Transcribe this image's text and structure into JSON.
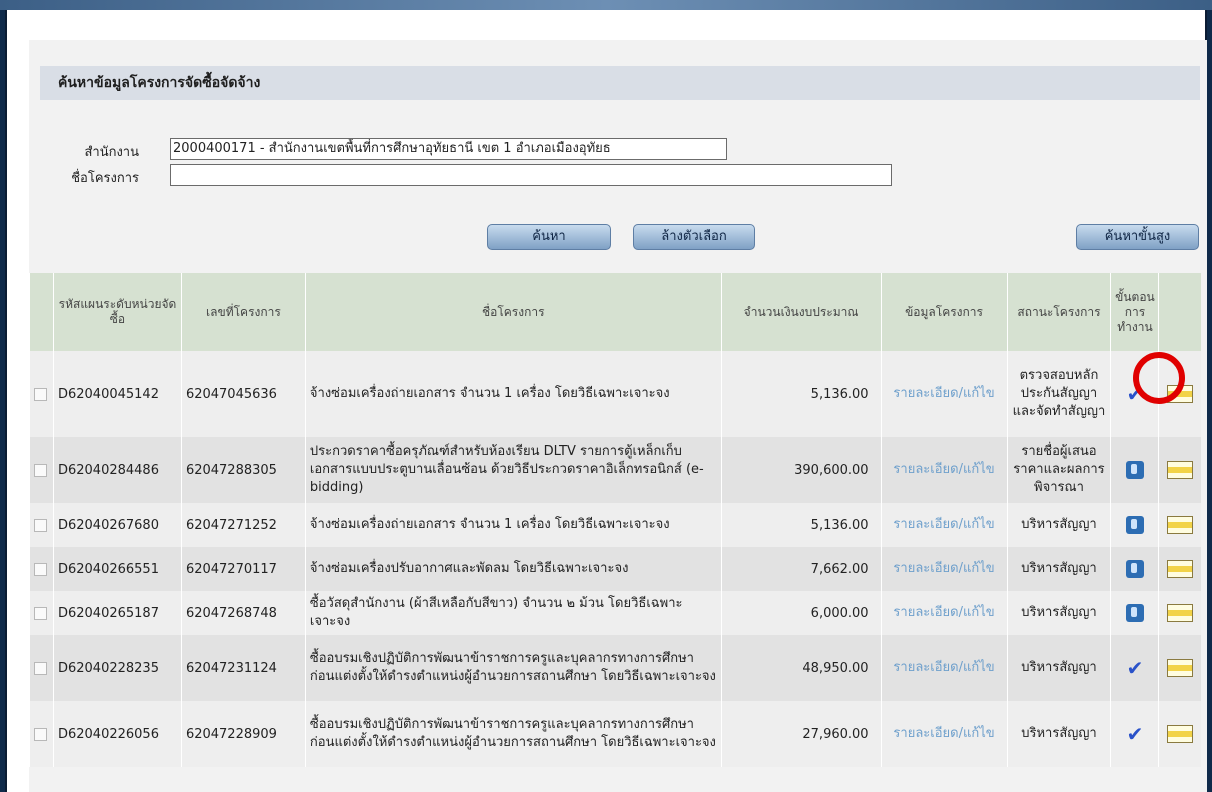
{
  "search": {
    "section_title": "ค้นหาข้อมูลโครงการจัดซื้อจัดจ้าง",
    "office_label": "สำนักงาน",
    "office_value": "2000400171 - สำนักงานเขตพื้นที่การศึกษาอุทัยธานี เขต 1 อำเภอเมืองอุทัยธ",
    "project_label": "ชื่อโครงการ",
    "project_value": "",
    "search_button": "ค้นหา",
    "clear_button": "ล้างตัวเลือก",
    "advanced_button": "ค้นหาขั้นสูง"
  },
  "table": {
    "headers": {
      "plan_code": "รหัสแผนระดับหน่วยจัดซื้อ",
      "project_no": "เลขที่โครงการ",
      "project_name": "ชื่อโครงการ",
      "budget": "จำนวนเงินงบประมาณ",
      "info": "ข้อมูลโครงการ",
      "status": "สถานะโครงการ",
      "step": "ขั้นตอนการทำงาน"
    },
    "rows": [
      {
        "plan_code": "D62040045142",
        "project_no": "62047045636",
        "name": "จ้างซ่อมเครื่องถ่ายเอกสาร จำนวน 1 เครื่อง โดยวิธีเฉพาะเจาะจง",
        "amount": "5,136.00",
        "link": "รายละเอียด/แก้ไข",
        "status": "ตรวจสอบหลักประกันสัญญาและจัดทำสัญญา",
        "step_icon": "check-icon"
      },
      {
        "plan_code": "D62040284486",
        "project_no": "62047288305",
        "name": "ประกวดราคาซื้อครุภัณฑ์สำหรับห้องเรียน DLTV รายการตู้เหล็กเก็บเอกสารแบบประตูบานเลื่อนซ้อน ด้วยวิธีประกวดราคาอิเล็กทรอนิกส์ (e-bidding)",
        "amount": "390,600.00",
        "link": "รายละเอียด/แก้ไข",
        "status": "รายชื่อผู้เสนอราคาและผลการพิจารณา",
        "step_icon": "tool-icon"
      },
      {
        "plan_code": "D62040267680",
        "project_no": "62047271252",
        "name": "จ้างซ่อมเครื่องถ่ายเอกสาร จำนวน 1 เครื่อง โดยวิธีเฉพาะเจาะจง",
        "amount": "5,136.00",
        "link": "รายละเอียด/แก้ไข",
        "status": "บริหารสัญญา",
        "step_icon": "tool-icon"
      },
      {
        "plan_code": "D62040266551",
        "project_no": "62047270117",
        "name": "จ้างซ่อมเครื่องปรับอากาศและพัดลม โดยวิธีเฉพาะเจาะจง",
        "amount": "7,662.00",
        "link": "รายละเอียด/แก้ไข",
        "status": "บริหารสัญญา",
        "step_icon": "tool-icon"
      },
      {
        "plan_code": "D62040265187",
        "project_no": "62047268748",
        "name": "ซื้อวัสดุสำนักงาน (ผ้าสีเหลือกับสีขาว) จำนวน ๒ ม้วน โดยวิธีเฉพาะเจาะจง",
        "amount": "6,000.00",
        "link": "รายละเอียด/แก้ไข",
        "status": "บริหารสัญญา",
        "step_icon": "tool-icon"
      },
      {
        "plan_code": "D62040228235",
        "project_no": "62047231124",
        "name": "ซื้ออบรมเชิงปฏิบัติการพัฒนาข้าราชการครูและบุคลากรทางการศึกษาก่อนแต่งตั้งให้ดำรงตำแหน่งผู้อำนวยการสถานศึกษา โดยวิธีเฉพาะเจาะจง",
        "amount": "48,950.00",
        "link": "รายละเอียด/แก้ไข",
        "status": "บริหารสัญญา",
        "step_icon": "check-icon"
      },
      {
        "plan_code": "D62040226056",
        "project_no": "62047228909",
        "name": "ซื้ออบรมเชิงปฏิบัติการพัฒนาข้าราชการครูและบุคลากรทางการศึกษาก่อนแต่งตั้งให้ดำรงตำแหน่งผู้อำนวยการสถานศึกษา โดยวิธีเฉพาะเจาะจง",
        "amount": "27,960.00",
        "link": "รายละเอียด/แก้ไข",
        "status": "บริหารสัญญา",
        "step_icon": "check-icon"
      }
    ]
  },
  "colors": {
    "header_bg": "#d6e1d1",
    "link": "#6fa0cc",
    "annotation_circle": "#e00000"
  }
}
